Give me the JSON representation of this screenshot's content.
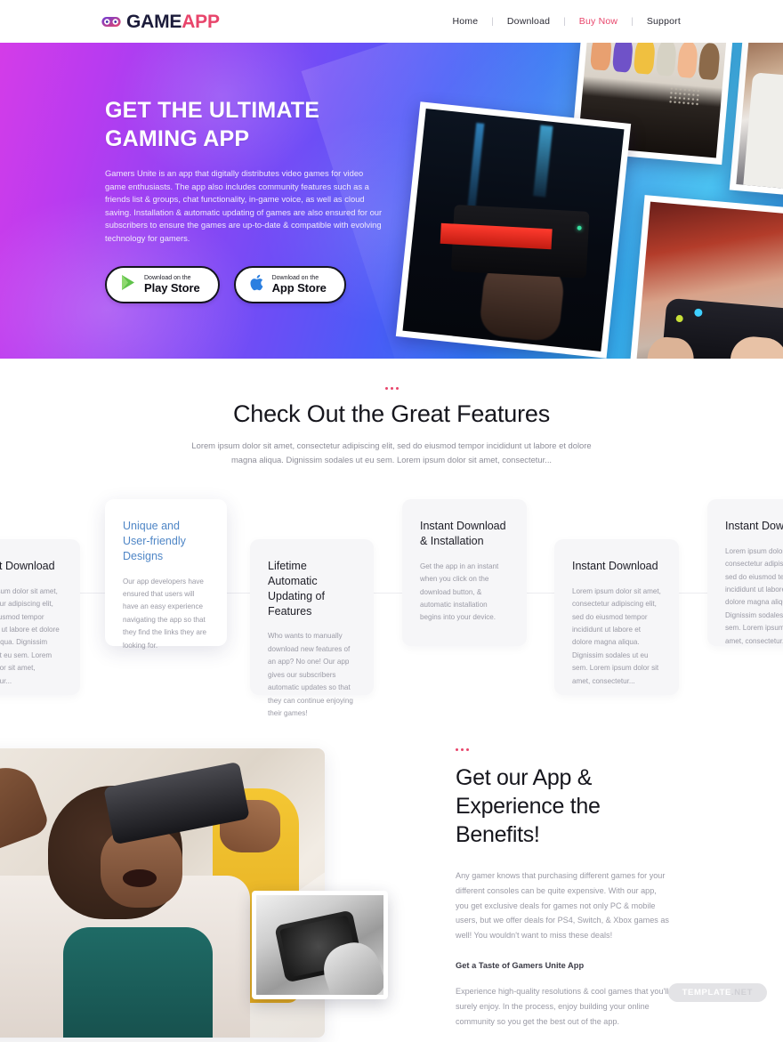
{
  "header": {
    "logo": {
      "icon": "gamepad-icon",
      "text_primary": "GAME",
      "text_accent": "APP"
    },
    "nav": [
      {
        "label": "Home",
        "accent": false
      },
      {
        "label": "Download",
        "accent": false
      },
      {
        "label": "Buy Now",
        "accent": true
      },
      {
        "label": "Support",
        "accent": false
      }
    ],
    "separator": "|"
  },
  "hero": {
    "title_line1": "GET THE ULTIMATE",
    "title_line2": "GAMING APP",
    "description": "Gamers Unite is an app that digitally distributes video games for video game enthusiasts.  The app also includes community features such as a friends list & groups, chat functionality, in-game voice, as well as cloud saving.  Installation & automatic updating of games are also ensured for our subscribers to ensure the games are up-to-date & compatible with evolving technology for gamers.",
    "buttons": [
      {
        "icon": "play-store-icon",
        "small": "Download on the",
        "big": "Play Store"
      },
      {
        "icon": "app-store-icon",
        "small": "Download on the",
        "big": "App Store"
      }
    ],
    "photos": [
      {
        "name": "vr-headset-photo"
      },
      {
        "name": "arcade-screen-photo"
      },
      {
        "name": "gamer-player-photo"
      },
      {
        "name": "controller-hands-photo"
      }
    ]
  },
  "features": {
    "title": "Check Out the Great Features",
    "subtitle": "Lorem ipsum dolor sit amet, consectetur adipiscing elit, sed do eiusmod tempor incididunt ut labore et dolore magna aliqua. Dignissim sodales ut eu sem. Lorem ipsum dolor sit amet, consectetur...",
    "cards": [
      {
        "title": "Instant Download",
        "body": "Lorem ipsum dolor sit amet, consectetur adipiscing elit, sed do eiusmod tempor incididunt ut labore et dolore magna aliqua. Dignissim sodales ut eu sem. Lorem ipsum dolor sit amet, consectetur...",
        "featured": false
      },
      {
        "title": "Unique and User-friendly Designs",
        "body": "Our app developers have ensured that users will have an easy experience navigating the app so that they find the links they are looking for.",
        "featured": true
      },
      {
        "title": "Lifetime Automatic Updating of Features",
        "body": "Who wants to manually download new features of an app? No one!  Our app gives our subscribers automatic updates so that they can continue enjoying their games!",
        "featured": false
      },
      {
        "title": "Instant Download & Installation",
        "body": "Get the app in an instant when you click on the download button, & automatic installation begins into your device.",
        "featured": false
      },
      {
        "title": "Instant Download",
        "body": "Lorem ipsum dolor sit amet, consectetur adipiscing elit, sed do eiusmod tempor incididunt ut labore et dolore magna aliqua. Dignissim sodales ut eu sem. Lorem ipsum dolor sit amet, consectetur...",
        "featured": false
      },
      {
        "title": "Instant Download",
        "body": "Lorem ipsum dolor sit amet, consectetur adipiscing elit, sed do eiusmod tempor incididunt ut labore et dolore magna aliqua. Dignissim sodales ut eu sem. Lorem ipsum dolor sit amet, consectetur...",
        "featured": false
      }
    ]
  },
  "benefits": {
    "title": "Get our App & Experience the Benefits!",
    "paragraph1": "Any gamer knows that purchasing different games for your different consoles can be quite expensive.  With our app, you get exclusive deals for games not only PC & mobile users, but we offer deals for PS4, Switch, & Xbox games as well!  You wouldn't want to miss these deals!",
    "subheading": "Get a Taste of Gamers Unite App",
    "paragraph2": "Experience high-quality resolutions & cool games that you'll surely enjoy.  In the process, enjoy building your online community so you get the best out of the app.",
    "photo_main": "vr-woman-photo",
    "photo_inset": "phone-game-photo"
  },
  "watermark": {
    "part1": "TEMPLATE",
    "part2": ".NET"
  },
  "colors": {
    "accent_pink": "#e8456b",
    "logo_navy": "#1b1b3a",
    "featured_title_blue": "#4f86c6",
    "body_grey": "#9a9aa5",
    "hero_gradient_start": "#d43ce8",
    "hero_gradient_mid": "#4a5cf7",
    "hero_gradient_end": "#3fbdf0"
  }
}
